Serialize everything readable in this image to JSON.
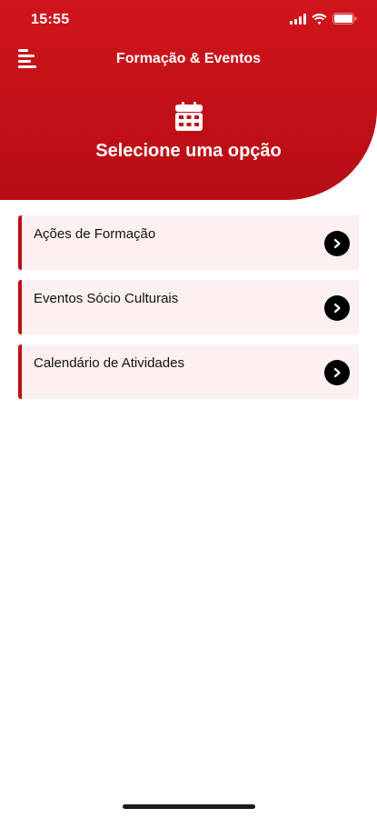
{
  "status_bar": {
    "time": "15:55",
    "icons": [
      "signal-icon",
      "wifi-icon",
      "battery-icon"
    ]
  },
  "header": {
    "title": "Formação & Eventos",
    "heading": "Selecione uma opção",
    "menu_icon": "menu-icon",
    "heading_icon": "calendar-icon"
  },
  "options": [
    {
      "label": "Ações de Formação",
      "icon": "chevron-right-icon"
    },
    {
      "label": "Eventos Sócio Culturais",
      "icon": "chevron-right-icon"
    },
    {
      "label": "Calendário de Atividades",
      "icon": "chevron-right-icon"
    }
  ],
  "colors": {
    "brand_red": "#c10f17",
    "card_background": "#fdf0f0",
    "arrow_button": "#000000"
  }
}
